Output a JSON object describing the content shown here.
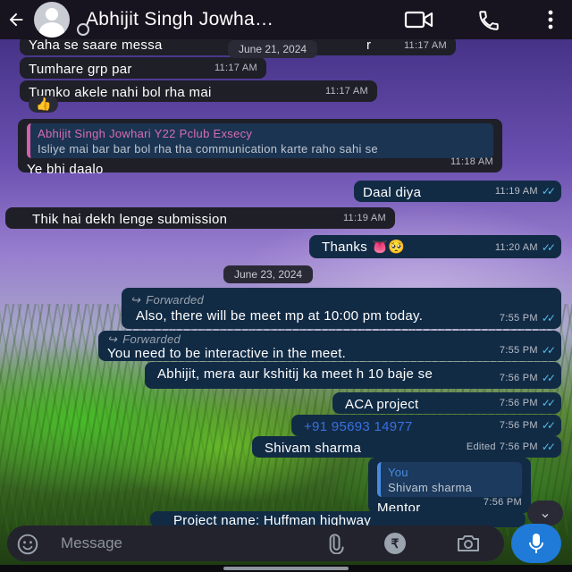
{
  "header": {
    "contact_name": "Abhijit Singh Jowha…",
    "back_icon": "arrow-left-icon",
    "video_icon": "video-call-icon",
    "call_icon": "phone-icon",
    "menu_icon": "more-vert-icon"
  },
  "dates": {
    "first": "June 21, 2024",
    "second": "June 23, 2024"
  },
  "messages": [
    {
      "text": "Yaha se saare messa",
      "extra": "r",
      "time": "11:17 AM"
    },
    {
      "text": "Tumhare grp par",
      "time": "11:17 AM"
    },
    {
      "text": "Tumko akele nahi bol rha mai",
      "time": "11:17 AM"
    },
    {
      "reaction": "👍"
    },
    {
      "quote_name": "Abhijit Singh Jowhari Y22 Pclub Exsecy",
      "quote_text": "Isliye mai bar bar bol rha tha communication karte raho sahi se",
      "text": "Ye bhi daalo",
      "time": "11:18 AM"
    },
    {
      "text": "Daal diya",
      "time": "11:19 AM"
    },
    {
      "text": "Thik hai dekh lenge submission",
      "time": "11:19 AM"
    },
    {
      "text": "Thanks 👅🥺",
      "time": "11:20 AM"
    },
    {
      "forward_label": "Forwarded",
      "text": "Also, there will be meet mp at 10:00 pm today.",
      "time": "7:55 PM"
    },
    {
      "forward_label": "Forwarded",
      "text": "You need to be interactive in the meet.",
      "time": "7:55 PM"
    },
    {
      "text": "Abhijit, mera aur kshitij ka meet h 10 baje se",
      "time": "7:56 PM"
    },
    {
      "text": "ACA project",
      "time": "7:56 PM"
    },
    {
      "text": "+91 95693 14977",
      "time": "7:56 PM"
    },
    {
      "text": "Shivam sharma",
      "edited": "Edited",
      "time": "7:56 PM"
    },
    {
      "quote_name": "You",
      "quote_text": "Shivam sharma",
      "text": "Mentor",
      "time": "7:56 PM"
    },
    {
      "text": "Project name:  Huffman highway"
    }
  ],
  "composer": {
    "placeholder": "Message",
    "emoji_icon": "emoji-icon",
    "attach_icon": "paperclip-icon",
    "payment_icon": "rupee-icon",
    "camera_icon": "camera-icon",
    "mic_icon": "microphone-icon"
  },
  "colors": {
    "incoming": "#1f1f28",
    "outgoing": "#122b45",
    "tick_blue": "#53bdeb",
    "mic_blue": "#1f7ad8",
    "quote_accent": "#d85fa8"
  }
}
